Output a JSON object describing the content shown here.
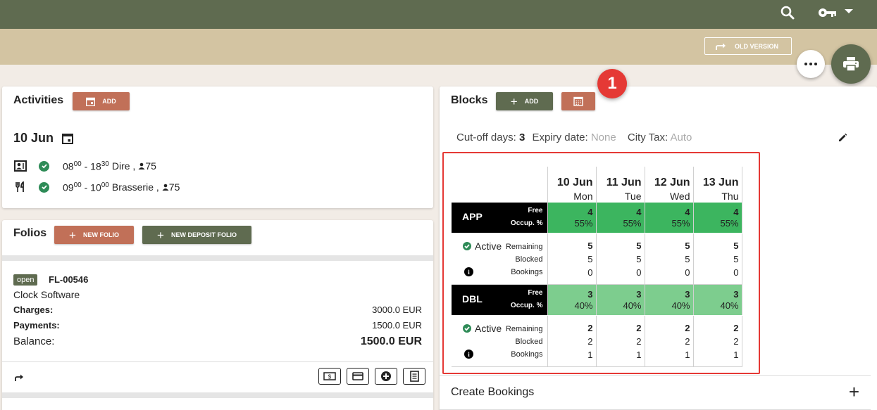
{
  "topbar": {
    "search_icon": "search-icon",
    "key_icon": "key-icon"
  },
  "subbar": {
    "old_version_label": "OLD VERSION"
  },
  "badge_number": "1",
  "activities": {
    "title": "Activities",
    "add_label": "ADD",
    "date": "10 Jun",
    "items": [
      {
        "icon": "meeting-room-icon",
        "start_h": "08",
        "start_m": "00",
        "end_h": "18",
        "end_m": "30",
        "name": "Dire ,",
        "persons": "75"
      },
      {
        "icon": "restaurant-icon",
        "start_h": "09",
        "start_m": "00",
        "end_h": "10",
        "end_m": "00",
        "name": "Brasserie ,",
        "persons": "75"
      }
    ]
  },
  "folios": {
    "title": "Folios",
    "new_folio_label": "NEW FOLIO",
    "new_deposit_label": "NEW DEPOSIT FOLIO",
    "folio": {
      "status": "open",
      "number": "FL-00546",
      "company": "Clock Software",
      "charges_label": "Charges:",
      "charges_value": "3000.0 EUR",
      "payments_label": "Payments:",
      "payments_value": "1500.0 EUR",
      "balance_label": "Balance:",
      "balance_value": "1500.0 EUR"
    }
  },
  "blocks": {
    "title": "Blocks",
    "add_label": "ADD",
    "cutoff_label": "Cut-off days:",
    "cutoff_value": "3",
    "expiry_label": "Expiry date:",
    "expiry_value": "None",
    "citytax_label": "City Tax:",
    "citytax_value": "Auto",
    "days": [
      {
        "date": "10 Jun",
        "weekday": "Mon"
      },
      {
        "date": "11 Jun",
        "weekday": "Tue"
      },
      {
        "date": "12 Jun",
        "weekday": "Wed"
      },
      {
        "date": "13 Jun",
        "weekday": "Thu"
      }
    ],
    "rooms": [
      {
        "code": "APP",
        "free_label": "Free",
        "occ_label": "Occup. %",
        "free": [
          "4",
          "4",
          "4",
          "4"
        ],
        "occ": [
          "55%",
          "55%",
          "55%",
          "55%"
        ],
        "status": "Active",
        "remaining_label": "Remaining",
        "blocked_label": "Blocked",
        "bookings_label": "Bookings",
        "remaining": [
          "5",
          "5",
          "5",
          "5"
        ],
        "blocked": [
          "5",
          "5",
          "5",
          "5"
        ],
        "bookings": [
          "0",
          "0",
          "0",
          "0"
        ]
      },
      {
        "code": "DBL",
        "free_label": "Free",
        "occ_label": "Occup. %",
        "free": [
          "3",
          "3",
          "3",
          "3"
        ],
        "occ": [
          "40%",
          "40%",
          "40%",
          "40%"
        ],
        "status": "Active",
        "remaining_label": "Remaining",
        "blocked_label": "Blocked",
        "bookings_label": "Bookings",
        "remaining": [
          "2",
          "2",
          "2",
          "2"
        ],
        "blocked": [
          "2",
          "2",
          "2",
          "2"
        ],
        "bookings": [
          "1",
          "1",
          "1",
          "1"
        ]
      }
    ],
    "create_bookings_label": "Create Bookings"
  }
}
